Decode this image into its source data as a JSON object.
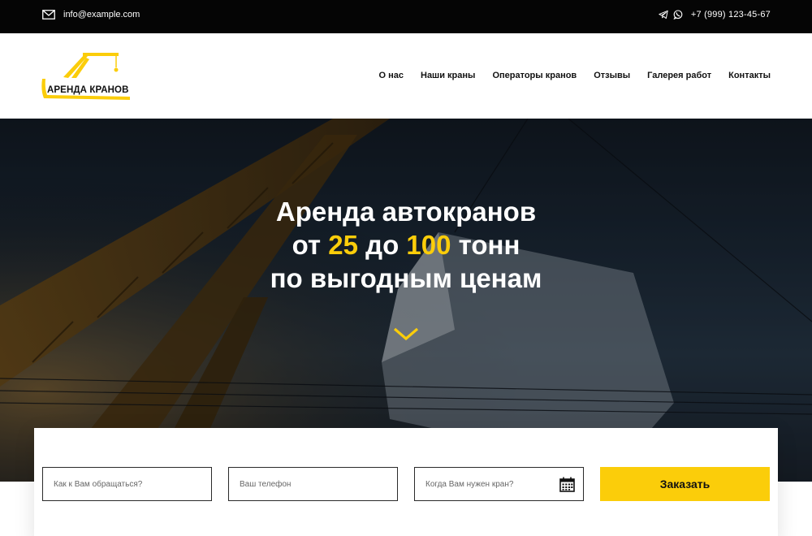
{
  "topbar": {
    "email": "info@example.com",
    "phone": "+7 (999) 123-45-67",
    "icons": {
      "email": "mail-icon",
      "telegram": "telegram-icon",
      "whatsapp": "whatsapp-icon"
    }
  },
  "header": {
    "logo_text": "АРЕНДА КРАНОВ",
    "nav": [
      {
        "label": "О нас"
      },
      {
        "label": "Наши краны"
      },
      {
        "label": "Операторы кранов"
      },
      {
        "label": "Отзывы"
      },
      {
        "label": "Галерея работ"
      },
      {
        "label": "Контакты"
      }
    ]
  },
  "hero": {
    "line1": "Аренда автокранов",
    "line2_pre": "от ",
    "line2_num1": "25",
    "line2_mid": " до ",
    "line2_num2": "100",
    "line2_post": " тонн",
    "line3": "по выгодным ценам",
    "scroll_icon": "chevron-down-icon"
  },
  "form": {
    "name_placeholder": "Как к Вам обращаться?",
    "phone_placeholder": "Ваш телефон",
    "date_placeholder": "Когда Вам нужен кран?",
    "submit_label": "Заказать",
    "calendar_icon": "calendar-icon"
  },
  "colors": {
    "accent": "#fbcd0a",
    "topbar": "#050505",
    "text": "#111111"
  }
}
